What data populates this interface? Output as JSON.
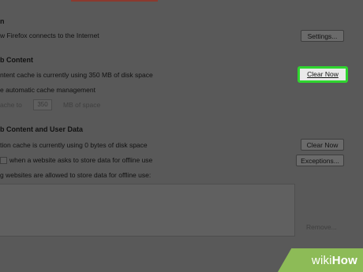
{
  "connection": {
    "heading": "n",
    "description": "w Firefox connects to the Internet",
    "settings_button": "Settings..."
  },
  "cached_content": {
    "heading": "b Content",
    "usage_text": "ntent cache is currently using 350 MB of disk space",
    "clear_button": "Clear Now",
    "override_label": "e automatic cache management",
    "limit_prefix": "ache to",
    "limit_value": "350",
    "limit_suffix": "MB of space"
  },
  "offline_content": {
    "heading": "b Content and User Data",
    "usage_text": "tion cache is currently using 0 bytes of disk space",
    "clear_button": "Clear Now",
    "ask_label": "when a website asks to store data for offline use",
    "exceptions_button": "Exceptions...",
    "allowed_label": "g websites are allowed to store data for offline use:",
    "remove_button": "Remove..."
  },
  "watermark": {
    "wiki": "wiki",
    "how": "How"
  },
  "colors": {
    "highlight": "#2fd52f",
    "watermark_bg": "#8dbb57"
  }
}
